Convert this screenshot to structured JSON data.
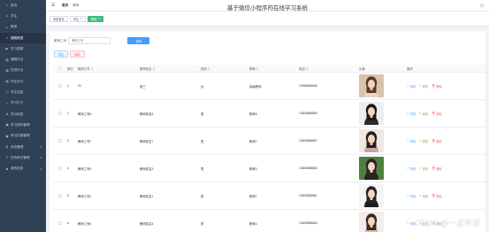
{
  "sidebar": {
    "items": [
      {
        "label": "首页",
        "icon": "home-icon",
        "active": false
      },
      {
        "label": "学生",
        "icon": "user-icon",
        "active": false
      },
      {
        "label": "教师",
        "icon": "user-icon",
        "active": false
      },
      {
        "label": "课程类型",
        "icon": "list-icon",
        "active": true
      },
      {
        "label": "学习视频",
        "icon": "video-icon",
        "active": false
      },
      {
        "label": "课程作业",
        "icon": "doc-icon",
        "active": false
      },
      {
        "label": "在线作业",
        "icon": "doc-icon",
        "active": false
      },
      {
        "label": "作业评分",
        "icon": "doc-icon",
        "active": false
      },
      {
        "label": "学生信息",
        "icon": "info-icon",
        "active": false
      },
      {
        "label": "学习打卡",
        "icon": "check-icon",
        "active": false
      },
      {
        "label": "学分信息",
        "icon": "star-icon",
        "active": false
      },
      {
        "label": "学习资料管理",
        "icon": "folder-icon",
        "active": false
      },
      {
        "label": "考试试题管理",
        "icon": "folder-icon",
        "active": false
      },
      {
        "label": "系统管理",
        "icon": "gear-icon",
        "active": false,
        "caret": true
      },
      {
        "label": "在线考试管理",
        "icon": "exam-icon",
        "active": false,
        "caret": true
      },
      {
        "label": "我的信息",
        "icon": "person-icon",
        "active": false,
        "caret": true
      }
    ]
  },
  "topbar": {
    "breadcrumb_home": "首页",
    "breadcrumb_current": "教师",
    "system_title": "基于微信小程序的在线学习系统"
  },
  "tags": {
    "items": [
      {
        "label": "系统首页",
        "active": false,
        "closable": false
      },
      {
        "label": "学生",
        "active": false,
        "closable": true
      },
      {
        "label": "教师",
        "active": true,
        "closable": true
      }
    ]
  },
  "search": {
    "label": "教师工号",
    "placeholder": "教师工号",
    "button_label": "查询"
  },
  "actions": {
    "export_label": "导出",
    "delete_label": "删除"
  },
  "table": {
    "columns": [
      "索引",
      "教师工号",
      "教师姓名",
      "性别",
      "职称",
      "电话",
      "头像",
      "操作"
    ],
    "rows": [
      {
        "index": "1",
        "no": "22",
        "name": "张三",
        "sex": "女",
        "title": "高级教师",
        "phone": "13966666666",
        "hair": "#5b3a24",
        "shirt": "#e8d7c4",
        "bg": "#d9c3ad"
      },
      {
        "index": "2",
        "no": "教师工号5",
        "name": "教师姓名5",
        "sex": "男",
        "title": "职称5",
        "phone": "13823888885",
        "hair": "#1f1a17",
        "shirt": "#2b2b2b",
        "bg": "#ededed"
      },
      {
        "index": "3",
        "no": "教师工号7",
        "name": "教师姓名7",
        "sex": "男",
        "title": "职称7",
        "phone": "13823888887",
        "hair": "#2a1e18",
        "shirt": "#c3a7a0",
        "bg": "#efe9e6"
      },
      {
        "index": "4",
        "no": "教师工号3",
        "name": "教师姓名3",
        "sex": "男",
        "title": "职称3",
        "phone": "13823888883",
        "hair": "#2a2320",
        "shirt": "#242424",
        "bg": "#4f7f3f"
      },
      {
        "index": "5",
        "no": "教师工号1",
        "name": "教师姓名1",
        "sex": "男",
        "title": "职称1",
        "phone": "13823888881",
        "hair": "#2a2320",
        "shirt": "#1c1c1c",
        "bg": "#f4f4f4"
      },
      {
        "index": "6",
        "no": "教师工号4",
        "name": "教师姓名4",
        "sex": "男",
        "title": "职称4",
        "phone": "13823888884",
        "hair": "#3a2a20",
        "shirt": "#e4b8a8",
        "bg": "#f3eeea"
      }
    ],
    "ops": {
      "detail": "详情",
      "edit": "修改",
      "delete": "删除"
    }
  },
  "watermark": "CSDN @一点毕设",
  "colors": {
    "sidebar_bg": "#304156",
    "primary": "#409eff",
    "tag_active": "#42b983",
    "danger": "#f56c6c",
    "success": "#67c23a"
  }
}
